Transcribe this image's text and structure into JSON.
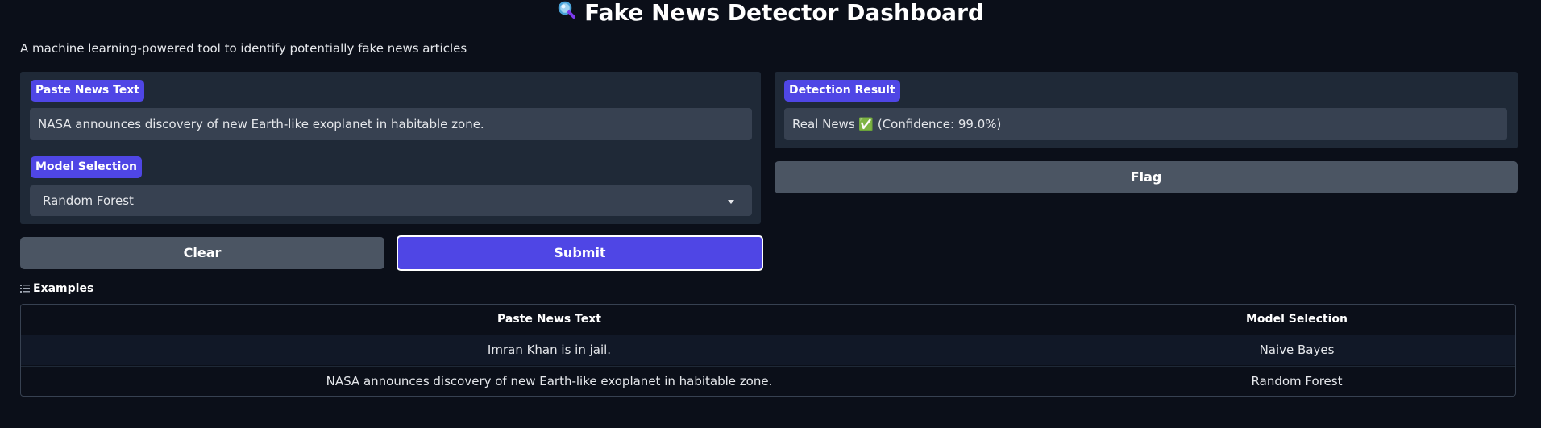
{
  "app": {
    "title_icon": "magnifier-icon",
    "title": "Fake News Detector Dashboard",
    "subtitle": "A machine learning-powered tool to identify potentially fake news articles"
  },
  "input_panel": {
    "text_label": "Paste News Text",
    "text_value": "NASA announces discovery of new Earth-like exoplanet in habitable zone.",
    "model_label": "Model Selection",
    "model_value": "Random Forest"
  },
  "output_panel": {
    "result_label": "Detection Result",
    "result_value": "Real News ✅ (Confidence: 99.0%)"
  },
  "buttons": {
    "clear": "Clear",
    "submit": "Submit",
    "flag": "Flag"
  },
  "examples": {
    "heading": "Examples",
    "columns": [
      "Paste News Text",
      "Model Selection"
    ],
    "rows": [
      [
        "Imran Khan is in jail.",
        "Naive Bayes"
      ],
      [
        "NASA announces discovery of new Earth-like exoplanet in habitable zone.",
        "Random Forest"
      ]
    ]
  },
  "colors": {
    "background": "#0b0f19",
    "panel": "#1f2937",
    "field": "#374151",
    "accent": "#4f46e5",
    "secondary_button": "#4b5563"
  }
}
